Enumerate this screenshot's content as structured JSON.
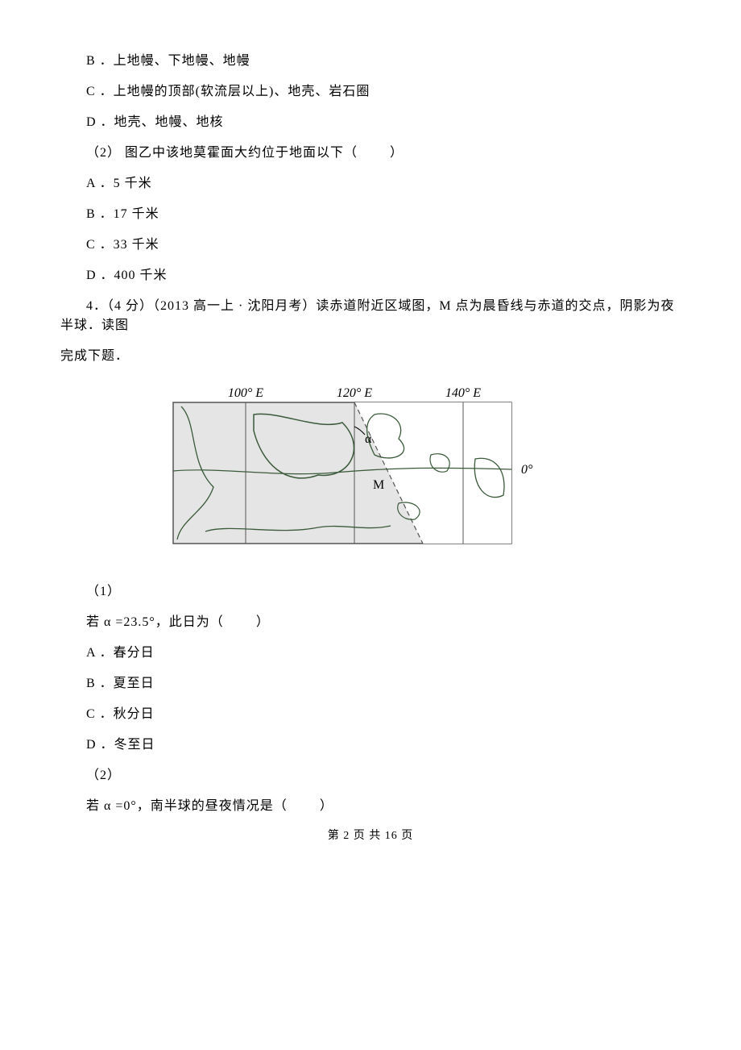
{
  "q3_part1": {
    "optB": "B ．上地幔、下地幔、地幔",
    "optC": "C ．上地幔的顶部(软流层以上)、地壳、岩石圈",
    "optD": "D ．地壳、地幔、地核",
    "sub2": "（2） 图乙中该地莫霍面大约位于地面以下（",
    "sub2_close": "）",
    "s2a": "A ．5 千米",
    "s2b": "B ．17 千米",
    "s2c": "C ．33 千米",
    "s2d": "D ．400 千米"
  },
  "q4": {
    "stem_a": "4．（4 分）（2013 高一上 · 沈阳月考）读赤道附近区域图，M 点为晨昏线与赤道的交点，阴影为夜半球．读图",
    "stem_b": "完成下题．",
    "sub1_num": "（1）",
    "sub1_text": "若 α =23.5°，此日为（",
    "sub1_close": "）",
    "s1a": "A ．春分日",
    "s1b": "B ．夏至日",
    "s1c": "C ．秋分日",
    "s1d": "D ．冬至日",
    "sub2_num": "（2）",
    "sub2_text": "若 α =0°，南半球的昼夜情况是（",
    "sub2_close": "）"
  },
  "map": {
    "l100": "100° E",
    "l120": "120° E",
    "l140": "140° E",
    "lat0": "0°",
    "alpha": "α",
    "m": "M"
  },
  "footer": "第 2 页 共 16 页"
}
